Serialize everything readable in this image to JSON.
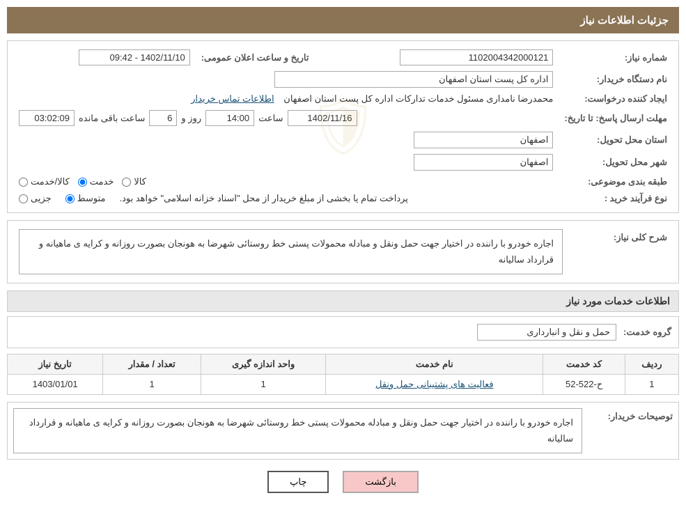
{
  "page": {
    "title": "جزئیات اطلاعات نیاز"
  },
  "header_fields": {
    "need_number_label": "شماره نیاز:",
    "need_number_value": "1102004342000121",
    "buyer_org_label": "نام دستگاه خریدار:",
    "buyer_org_value": "اداره کل پست استان اصفهان",
    "date_label": "تاریخ و ساعت اعلان عمومی:",
    "date_value": "1402/11/10 - 09:42",
    "creator_label": "ایجاد کننده درخواست:",
    "creator_value": "محمدرضا نامداری مسئول خدمات تدارکات اداره کل پست استان اصفهان",
    "contact_link": "اطلاعات تماس خریدار",
    "deadline_label": "مهلت ارسال پاسخ: تا تاریخ:",
    "deadline_date": "1402/11/16",
    "deadline_time_label": "ساعت",
    "deadline_time": "14:00",
    "deadline_days_label": "روز و",
    "deadline_days": "6",
    "deadline_remaining_label": "ساعت باقی مانده",
    "deadline_remaining": "03:02:09",
    "delivery_province_label": "استان محل تحویل:",
    "delivery_province_value": "اصفهان",
    "delivery_city_label": "شهر محل تحویل:",
    "delivery_city_value": "اصفهان",
    "category_label": "طبقه بندی موضوعی:",
    "category_options": [
      "کالا",
      "خدمت",
      "کالا/خدمت"
    ],
    "category_selected": "خدمت",
    "proc_type_label": "نوع فرآیند خرید :",
    "proc_options": [
      "جزیی",
      "متوسط"
    ],
    "proc_selected": "متوسط",
    "proc_note": "پرداخت تمام یا بخشی از مبلغ خریدار از محل \"اسناد خزانه اسلامی\" خواهد بود."
  },
  "description_section": {
    "title": "شرح کلی نیاز:",
    "text": "اجاره خودرو با راننده در اختیار جهت حمل ونقل و مبادله محمولات  پستی خط روستائی شهرضا به هونجان بصورت روزانه و کرایه ی ماهیانه و قرارداد سالیانه"
  },
  "services_section": {
    "title": "اطلاعات خدمات مورد نیاز",
    "group_label": "گروه خدمت:",
    "group_value": "حمل و نقل و انبارداری",
    "table": {
      "columns": [
        "ردیف",
        "کد خدمت",
        "نام خدمت",
        "واحد اندازه گیری",
        "تعداد / مقدار",
        "تاریخ نیاز"
      ],
      "rows": [
        {
          "row_num": "1",
          "service_code": "ح-522-52",
          "service_name": "فعالیت های پشتیبانی حمل ونقل",
          "unit": "1",
          "quantity": "1",
          "date": "1403/01/01"
        }
      ]
    }
  },
  "buyer_notes": {
    "label": "توصیحات خریدار:",
    "text": "اجاره خودرو با راننده در اختیار جهت حمل ونقل و مبادله محمولات  پستی خط روستائی شهرضا به هونجان بصورت روزانه و کرایه ی ماهیانه و قرارداد سالیانه"
  },
  "buttons": {
    "print": "چاپ",
    "back": "بازگشت"
  }
}
